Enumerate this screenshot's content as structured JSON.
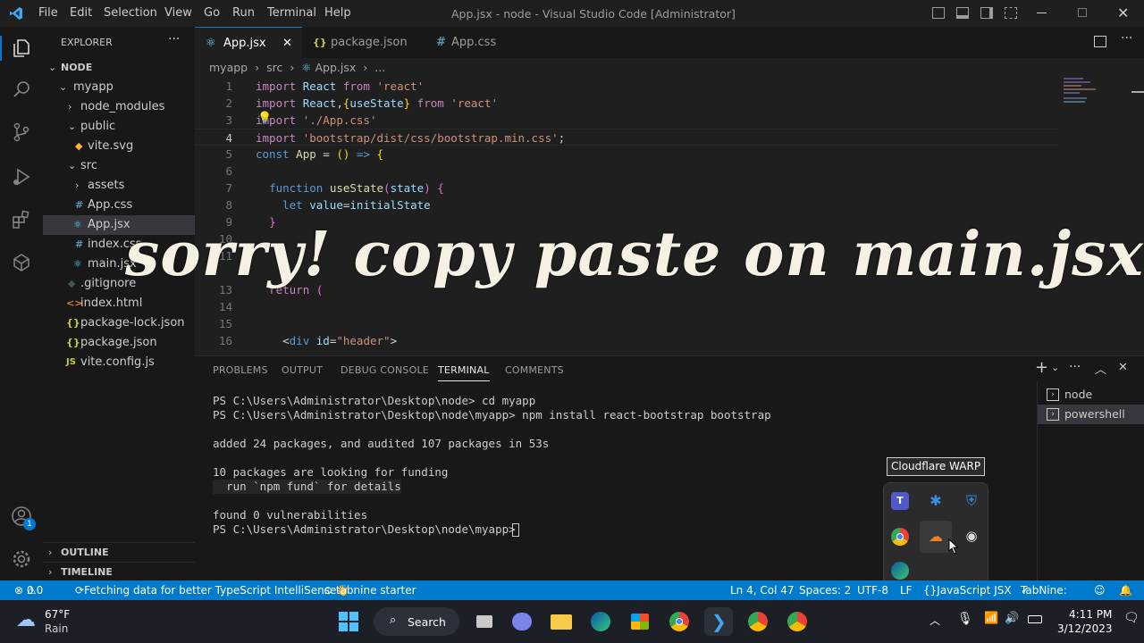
{
  "titlebar": {
    "menu": [
      "File",
      "Edit",
      "Selection",
      "View",
      "Go",
      "Run",
      "Terminal",
      "Help"
    ],
    "title": "App.jsx - node - Visual Studio Code [Administrator]"
  },
  "explorer": {
    "header": "EXPLORER",
    "root": "NODE",
    "items": [
      {
        "label": "myapp",
        "type": "folder-open"
      },
      {
        "label": "node_modules",
        "type": "folder"
      },
      {
        "label": "public",
        "type": "folder-open"
      },
      {
        "label": "vite.svg",
        "type": "svg"
      },
      {
        "label": "src",
        "type": "folder-open"
      },
      {
        "label": "assets",
        "type": "folder"
      },
      {
        "label": "App.css",
        "type": "css"
      },
      {
        "label": "App.jsx",
        "type": "react"
      },
      {
        "label": "index.css",
        "type": "css"
      },
      {
        "label": "main.jsx",
        "type": "react"
      },
      {
        "label": ".gitignore",
        "type": "git"
      },
      {
        "label": "index.html",
        "type": "html"
      },
      {
        "label": "package-lock.json",
        "type": "json"
      },
      {
        "label": "package.json",
        "type": "json"
      },
      {
        "label": "vite.config.js",
        "type": "js"
      }
    ],
    "outline": "OUTLINE",
    "timeline": "TIMELINE"
  },
  "tabs": [
    {
      "label": "App.jsx",
      "icon": "react-icon",
      "active": true
    },
    {
      "label": "package.json",
      "icon": "json-icon",
      "active": false
    },
    {
      "label": "App.css",
      "icon": "css-icon",
      "active": false
    }
  ],
  "breadcrumb": [
    "myapp",
    "src",
    "App.jsx",
    "..."
  ],
  "code": {
    "line_numbers": [
      "1",
      "2",
      "3",
      "4",
      "5",
      "6",
      "7",
      "8",
      "9",
      "10",
      "11",
      "13",
      "14",
      "15",
      "16"
    ],
    "current_line": "4"
  },
  "overlay_text": "sorry! copy paste on main.jsx",
  "panel": {
    "tabs": [
      "PROBLEMS",
      "OUTPUT",
      "DEBUG CONSOLE",
      "TERMINAL",
      "COMMENTS"
    ],
    "active_tab": "TERMINAL",
    "terminal_lines": [
      "PS C:\\Users\\Administrator\\Desktop\\node> cd myapp",
      "PS C:\\Users\\Administrator\\Desktop\\node\\myapp> npm install react-bootstrap bootstrap",
      "",
      "added 24 packages, and audited 107 packages in 53s",
      "",
      "10 packages are looking for funding",
      "  run `npm fund` for details",
      "",
      "found 0 vulnerabilities",
      "PS C:\\Users\\Administrator\\Desktop\\node\\myapp> "
    ],
    "terminal_instances": [
      "node",
      "powershell"
    ]
  },
  "statusbar": {
    "problems": "0",
    "warnings": "0",
    "fetching": "Fetching data for better TypeScript IntelliSense",
    "tabnine": "tabnine starter",
    "position": "Ln 4, Col 47",
    "spaces": "Spaces: 2",
    "encoding": "UTF-8",
    "eol": "LF",
    "language": "JavaScript JSX",
    "tabnine_right": "TabNine:"
  },
  "tray_tooltip": "Cloudflare WARP",
  "taskbar": {
    "weather_temp": "67°F",
    "weather_desc": "Rain",
    "search": "Search",
    "time": "4:11 PM",
    "date": "3/12/2023"
  },
  "colors": {
    "accent": "#007acc",
    "activity_badge": "#0078d4"
  }
}
